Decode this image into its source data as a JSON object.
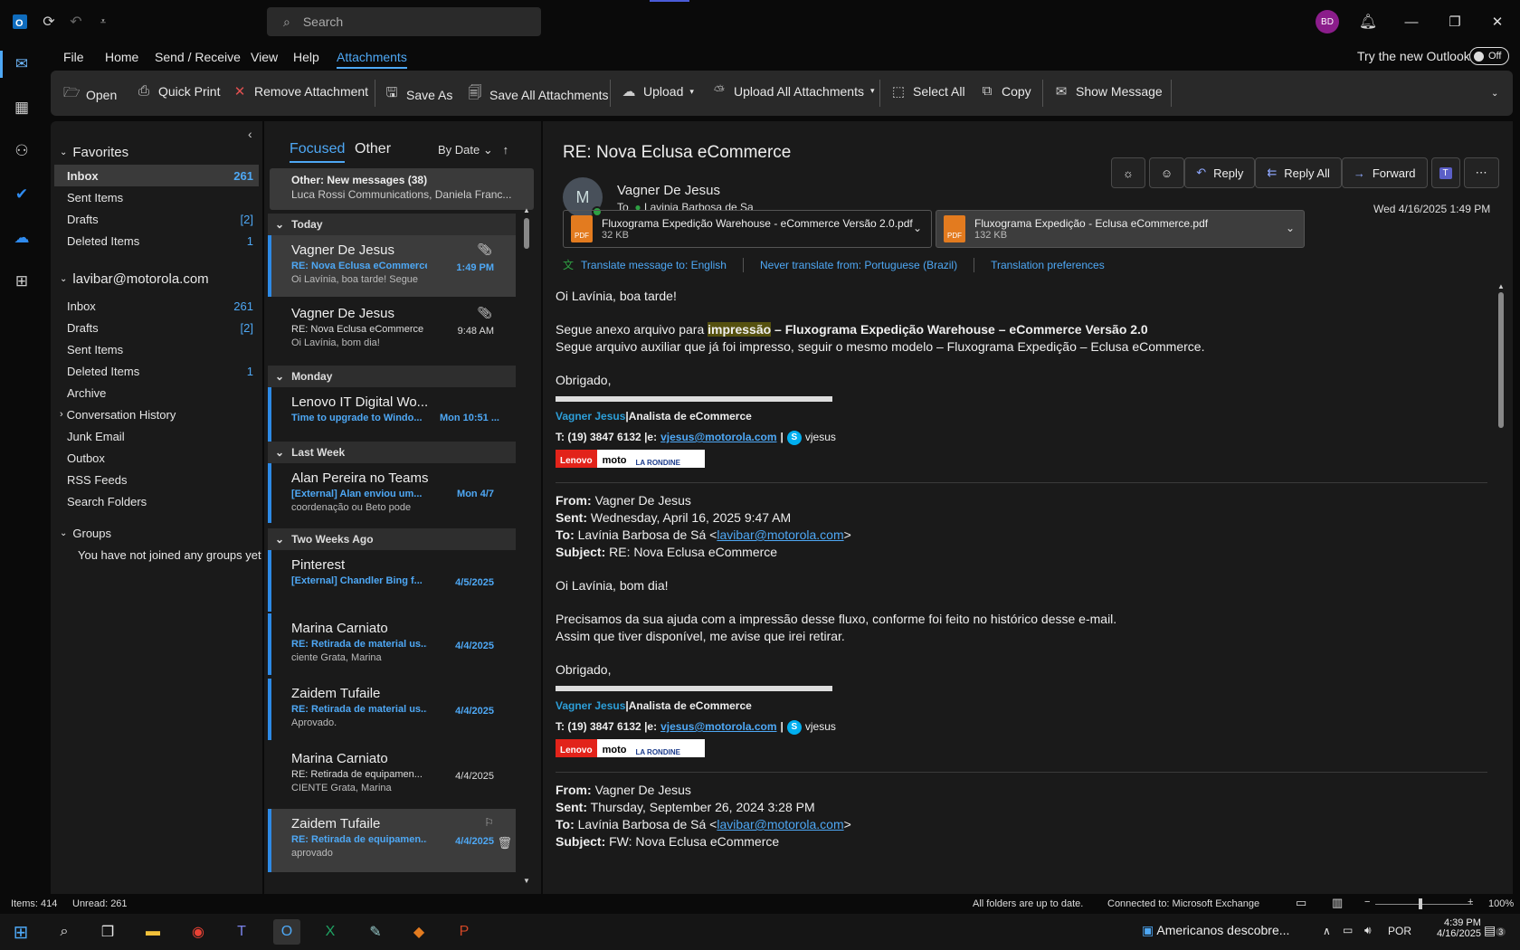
{
  "titlebar": {
    "search_placeholder": "Search",
    "avatar_initials": "BD"
  },
  "menu": {
    "items": [
      "File",
      "Home",
      "Send / Receive",
      "View",
      "Help",
      "Attachments"
    ],
    "try_new": "Try the new Outlook",
    "toggle": "Off"
  },
  "ribbon": {
    "open": "Open",
    "quick_print": "Quick Print",
    "remove": "Remove Attachment",
    "save_as": "Save As",
    "save_all": "Save All Attachments",
    "upload": "Upload",
    "upload_all": "Upload All Attachments",
    "select_all": "Select All",
    "copy": "Copy",
    "show_message": "Show Message"
  },
  "folders": {
    "favorites_label": "Favorites",
    "favorites": [
      {
        "name": "Inbox",
        "count": "261"
      },
      {
        "name": "Sent Items",
        "count": ""
      },
      {
        "name": "Drafts",
        "count": "[2]"
      },
      {
        "name": "Deleted Items",
        "count": "1"
      }
    ],
    "account_label": "lavibar@motorola.com",
    "account": [
      {
        "name": "Inbox",
        "count": "261"
      },
      {
        "name": "Drafts",
        "count": "[2]"
      },
      {
        "name": "Sent Items",
        "count": ""
      },
      {
        "name": "Deleted Items",
        "count": "1"
      },
      {
        "name": "Archive",
        "count": ""
      },
      {
        "name": "Conversation History",
        "count": ""
      },
      {
        "name": "Junk Email",
        "count": ""
      },
      {
        "name": "Outbox",
        "count": ""
      },
      {
        "name": "RSS Feeds",
        "count": ""
      },
      {
        "name": "Search Folders",
        "count": ""
      }
    ],
    "groups_label": "Groups",
    "groups_empty": "You have not joined any groups yet"
  },
  "list": {
    "tab_focused": "Focused",
    "tab_other": "Other",
    "sort": "By Date",
    "other_title": "Other: New messages (38)",
    "other_preview": "Luca Rossi Communications, Daniela Franc...",
    "groups": [
      "Today",
      "Monday",
      "Last Week",
      "Two Weeks Ago"
    ],
    "mails": [
      {
        "from": "Vagner De Jesus",
        "subject": "RE: Nova Eclusa eCommerce",
        "preview": "Oi Lavínia, boa tarde!  Segue",
        "time": "1:49 PM"
      },
      {
        "from": "Vagner De Jesus",
        "subject": "RE: Nova Eclusa eCommerce",
        "preview": "Oi Lavínia, bom dia!",
        "time": "9:48 AM"
      },
      {
        "from": "Lenovo IT Digital Wo...",
        "subject": "Time to upgrade to Windo...",
        "preview": "",
        "time": "Mon 10:51 ..."
      },
      {
        "from": "Alan Pereira no Teams",
        "subject": "[External] Alan enviou um...",
        "preview": "coordenação ou Beto pode",
        "time": "Mon 4/7"
      },
      {
        "from": "Pinterest",
        "subject": "[External] Chandler Bing f...",
        "preview": "",
        "time": "4/5/2025"
      },
      {
        "from": "Marina Carniato",
        "subject": "RE: Retirada de material us...",
        "preview": "ciente  Grata,  Marina",
        "time": "4/4/2025"
      },
      {
        "from": "Zaidem Tufaile",
        "subject": "RE: Retirada de material us...",
        "preview": "Aprovado.",
        "time": "4/4/2025"
      },
      {
        "from": "Marina Carniato",
        "subject": "RE: Retirada de equipamen...",
        "preview": "CIENTE   Grata,  Marina",
        "time": "4/4/2025"
      },
      {
        "from": "Zaidem Tufaile",
        "subject": "RE: Retirada de equipamen...",
        "preview": "aprovado",
        "time": "4/4/2025"
      }
    ]
  },
  "reading": {
    "subject": "RE: Nova Eclusa eCommerce",
    "sender": "Vagner De Jesus",
    "to_label": "To",
    "to": "Lavinia Barbosa de Sa",
    "date": "Wed 4/16/2025 1:49 PM",
    "actions": {
      "reply": "Reply",
      "reply_all": "Reply All",
      "forward": "Forward"
    },
    "attachments": [
      {
        "name": "Fluxograma Expedição Warehouse - eCommerce Versão 2.0.pdf",
        "size": "32 KB"
      },
      {
        "name": "Fluxograma Expedição - Eclusa eCommerce.pdf",
        "size": "132 KB"
      }
    ],
    "translate": {
      "t1": "Translate message to: English",
      "t2": "Never translate from: Portuguese (Brazil)",
      "t3": "Translation preferences"
    },
    "body": {
      "greeting": "Oi Lavínia, boa tarde!",
      "line1a": "Segue anexo arquivo para ",
      "line1b": "impressão",
      "line1c": " – Fluxograma Expedição Warehouse – eCommerce Versão 2.0",
      "line2": "Segue arquivo auxiliar que já foi impresso, seguir o mesmo modelo – Fluxograma Expedição – Eclusa eCommerce.",
      "thanks": "Obrigado,",
      "sig_name": "Vagner Jesus",
      "sig_sep": "|",
      "sig_title": "Analista de eCommerce",
      "sig_phone": "T: (19) 3847 6132 |e: ",
      "sig_email": "vjesus@motorola.com",
      "sig_pipe": " | ",
      "sig_skype": "vjesus",
      "logo_lenovo": "Lenovo",
      "logo_moto": "moto",
      "logo_lr": "LA RONDINE",
      "q1_from": "Vagner De Jesus",
      "q1_sent": "Wednesday, April 16, 2025 9:47 AM",
      "q1_to": "Lavínia Barbosa de Sá <",
      "q1_to_email": "lavibar@motorola.com",
      "q1_subject": "RE: Nova Eclusa eCommerce",
      "q1_greeting": "Oi Lavínia, bom dia!",
      "q1_l1": "Precisamos da sua ajuda com a impressão desse fluxo, conforme foi feito no histórico desse e-mail.",
      "q1_l2": "Assim que tiver disponível, me avise que irei retirar.",
      "q2_from": "Vagner De Jesus",
      "q2_sent": "Thursday, September 26, 2024 3:28 PM",
      "q2_to": "Lavínia Barbosa de Sá <",
      "q2_to_email": "lavibar@motorola.com",
      "q2_subject": "FW: Nova Eclusa eCommerce",
      "lbl_from": "From:",
      "lbl_sent": "Sent:",
      "lbl_to": "To:",
      "lbl_subject": "Subject:"
    }
  },
  "status": {
    "items": "Items: 414",
    "unread": "Unread: 261",
    "sync": "All folders are up to date.",
    "conn": "Connected to: Microsoft Exchange",
    "zoom": "100%"
  },
  "taskbar": {
    "news": "Americanos descobre...",
    "lang": "POR",
    "time": "4:39 PM",
    "date": "4/16/2025",
    "notif": "3"
  }
}
